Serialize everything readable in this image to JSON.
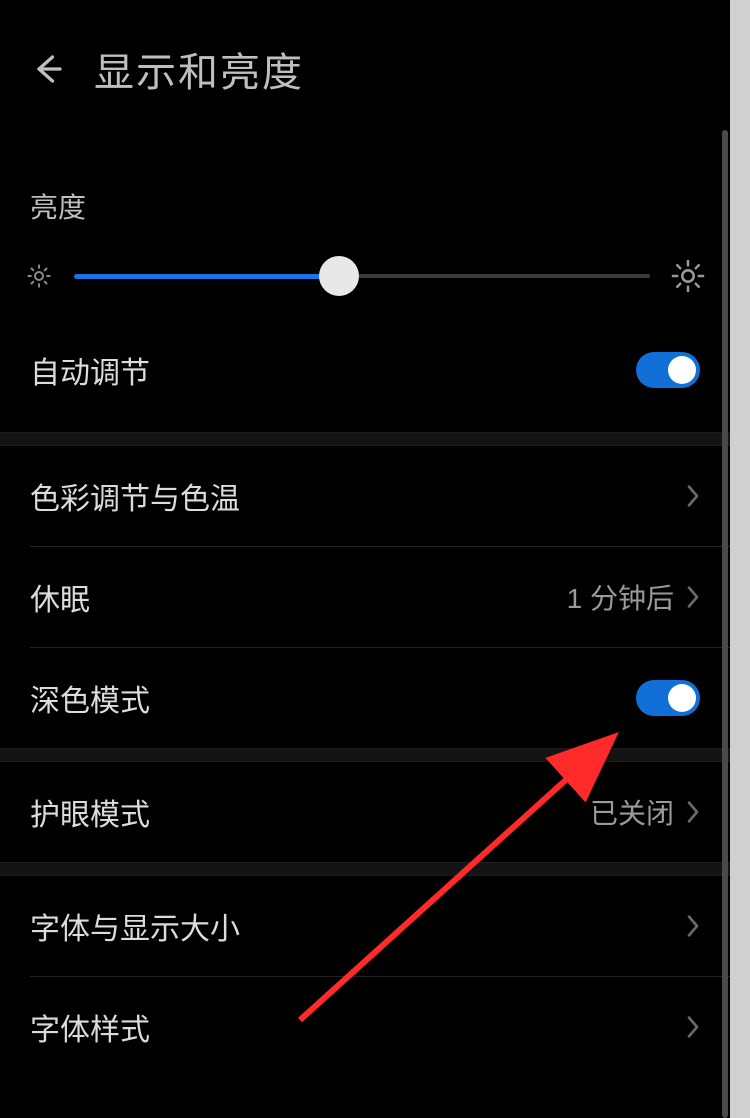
{
  "header": {
    "title": "显示和亮度"
  },
  "brightness": {
    "label": "亮度",
    "value_percent": 46
  },
  "rows": {
    "auto_adjust": {
      "label": "自动调节",
      "toggle_on": true
    },
    "color_temp": {
      "label": "色彩调节与色温"
    },
    "sleep": {
      "label": "休眠",
      "value": "1 分钟后"
    },
    "dark_mode": {
      "label": "深色模式",
      "toggle_on": true
    },
    "eye_comfort": {
      "label": "护眼模式",
      "value": "已关闭"
    },
    "font_display": {
      "label": "字体与显示大小"
    },
    "font_style": {
      "label": "字体样式"
    }
  },
  "colors": {
    "accent": "#1170d8",
    "slider_fill": "#1a73e8",
    "arrow": "#ff2a2a"
  }
}
